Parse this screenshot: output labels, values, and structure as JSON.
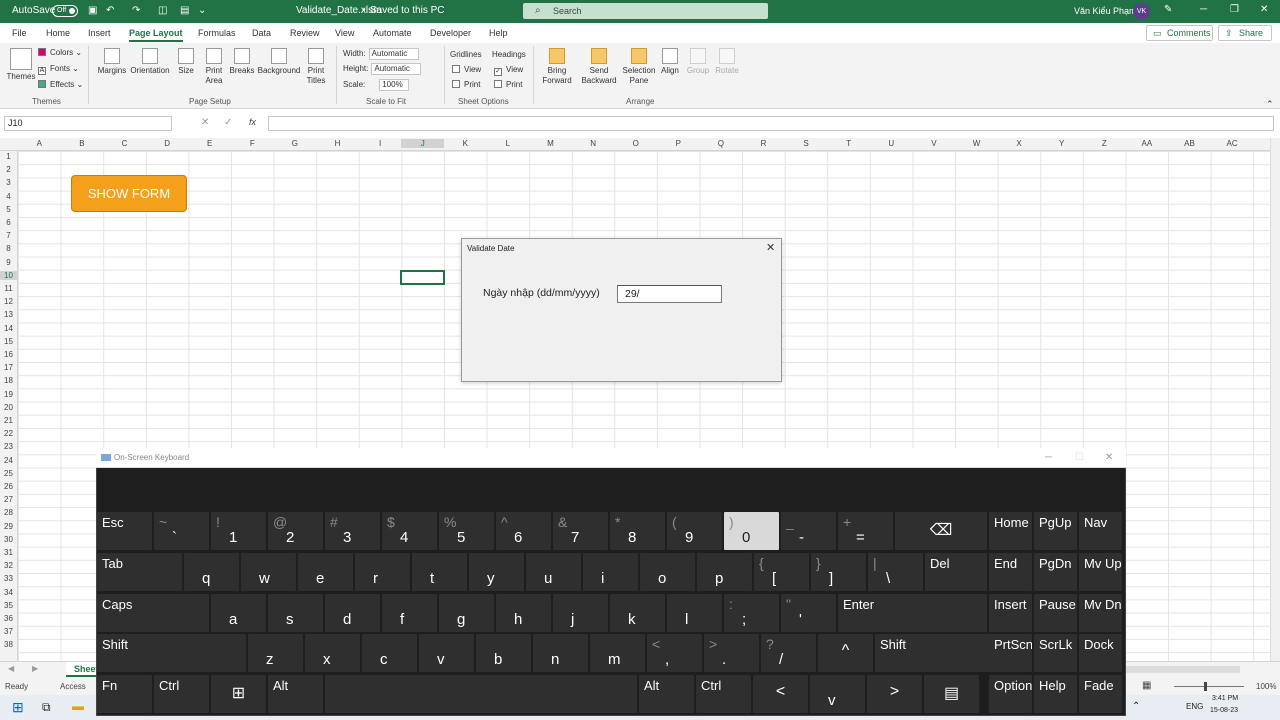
{
  "titlebar": {
    "autosave_label": "AutoSave",
    "autosave_state": "Off",
    "file_name": "Validate_Date.xlsm",
    "save_status": "Saved to this PC",
    "search_placeholder": "Search",
    "user_name": "Văn Kiểu Phạm",
    "user_initials": "VK"
  },
  "menu": [
    "File",
    "Home",
    "Insert",
    "Page Layout",
    "Formulas",
    "Data",
    "Review",
    "View",
    "Automate",
    "Developer",
    "Help"
  ],
  "menu_active": "Page Layout",
  "top_buttons": {
    "comments": "Comments",
    "share": "Share"
  },
  "ribbon": {
    "themes": {
      "themes": "Themes",
      "colors": "Colors",
      "fonts": "Fonts",
      "effects": "Effects",
      "group": "Themes"
    },
    "page_setup": {
      "margins": "Margins",
      "orientation": "Orientation",
      "size": "Size",
      "print_area": "Print Area",
      "breaks": "Breaks",
      "background": "Background",
      "print_titles": "Print Titles",
      "group": "Page Setup"
    },
    "scale": {
      "width_label": "Width:",
      "width_value": "Automatic",
      "height_label": "Height:",
      "height_value": "Automatic",
      "scale_label": "Scale:",
      "scale_value": "100%",
      "group": "Scale to Fit"
    },
    "sheet_options": {
      "gridlines": "Gridlines",
      "headings": "Headings",
      "view": "View",
      "print": "Print",
      "group": "Sheet Options"
    },
    "arrange": {
      "bring_forward": "Bring Forward",
      "send_backward": "Send Backward",
      "selection_pane": "Selection Pane",
      "align": "Align",
      "group_btn": "Group",
      "rotate": "Rotate",
      "group": "Arrange"
    }
  },
  "formula_bar": {
    "name_box": "J10",
    "fx": "fx"
  },
  "columns": [
    "A",
    "B",
    "C",
    "D",
    "E",
    "F",
    "G",
    "H",
    "I",
    "J",
    "K",
    "L",
    "M",
    "N",
    "O",
    "P",
    "Q",
    "R",
    "S",
    "T",
    "U",
    "V",
    "W",
    "X",
    "Y",
    "Z",
    "AA",
    "AB",
    "AC"
  ],
  "rows": [
    "1",
    "2",
    "3",
    "4",
    "5",
    "6",
    "7",
    "8",
    "9",
    "10",
    "11",
    "12",
    "13",
    "14",
    "15",
    "16",
    "17",
    "18",
    "19",
    "20",
    "21",
    "22",
    "23",
    "24",
    "25",
    "26",
    "27",
    "28",
    "29",
    "30",
    "31",
    "32",
    "33",
    "34",
    "35",
    "36",
    "37",
    "38"
  ],
  "selected_cell": "J10",
  "show_form_button": "SHOW FORM",
  "dialog": {
    "title": "Validate Date",
    "label": "Ngày nhập (dd/mm/yyyy)",
    "input_value": "29/"
  },
  "sheet_tab": "Sheet",
  "status": {
    "ready": "Ready",
    "accessibility": "Access",
    "zoom": "100%",
    "time": "3:41 PM",
    "date": "15-08-23",
    "language": "ENG"
  },
  "osk": {
    "title": "On-Screen Keyboard",
    "rows": [
      [
        {
          "label": "Esc"
        },
        {
          "up": "~",
          "dn": "`"
        },
        {
          "up": "!",
          "dn": "1"
        },
        {
          "up": "@",
          "dn": "2"
        },
        {
          "up": "#",
          "dn": "3"
        },
        {
          "up": "$",
          "dn": "4"
        },
        {
          "up": "%",
          "dn": "5"
        },
        {
          "up": "^",
          "dn": "6"
        },
        {
          "up": "&",
          "dn": "7"
        },
        {
          "up": "*",
          "dn": "8"
        },
        {
          "up": "(",
          "dn": "9"
        },
        {
          "up": ")",
          "dn": "0"
        },
        {
          "up": "_",
          "dn": "-"
        },
        {
          "up": "+",
          "dn": "="
        },
        {
          "label": "⌫"
        }
      ],
      [
        {
          "label": "Tab"
        },
        {
          "label": "q"
        },
        {
          "label": "w"
        },
        {
          "label": "e"
        },
        {
          "label": "r"
        },
        {
          "label": "t"
        },
        {
          "label": "y"
        },
        {
          "label": "u"
        },
        {
          "label": "i"
        },
        {
          "label": "o"
        },
        {
          "label": "p"
        },
        {
          "up": "{",
          "dn": "["
        },
        {
          "up": "}",
          "dn": "]"
        },
        {
          "up": "|",
          "dn": "\\"
        },
        {
          "label": "Del"
        }
      ],
      [
        {
          "label": "Caps"
        },
        {
          "label": "a"
        },
        {
          "label": "s"
        },
        {
          "label": "d"
        },
        {
          "label": "f"
        },
        {
          "label": "g"
        },
        {
          "label": "h"
        },
        {
          "label": "j"
        },
        {
          "label": "k"
        },
        {
          "label": "l"
        },
        {
          "up": ":",
          "dn": ";"
        },
        {
          "up": "\"",
          "dn": "'"
        },
        {
          "label": "Enter"
        }
      ],
      [
        {
          "label": "Shift"
        },
        {
          "label": "z"
        },
        {
          "label": "x"
        },
        {
          "label": "c"
        },
        {
          "label": "v"
        },
        {
          "label": "b"
        },
        {
          "label": "n"
        },
        {
          "label": "m"
        },
        {
          "up": "<",
          "dn": ","
        },
        {
          "up": ">",
          "dn": "."
        },
        {
          "up": "?",
          "dn": "/"
        },
        {
          "label": "^"
        },
        {
          "label": "Shift"
        }
      ],
      [
        {
          "label": "Fn"
        },
        {
          "label": "Ctrl"
        },
        {
          "label": "⊞"
        },
        {
          "label": "Alt"
        },
        {
          "label": ""
        },
        {
          "label": "Alt"
        },
        {
          "label": "Ctrl"
        },
        {
          "label": "<"
        },
        {
          "label": "v"
        },
        {
          "label": ">"
        },
        {
          "label": "▤"
        }
      ]
    ],
    "nav": [
      [
        "Home",
        "PgUp",
        "Nav"
      ],
      [
        "End",
        "PgDn",
        "Mv Up"
      ],
      [
        "Insert",
        "Pause",
        "Mv Dn"
      ],
      [
        "PrtScn",
        "ScrLk",
        "Dock"
      ],
      [
        "Options",
        "Help",
        "Fade"
      ]
    ],
    "pressed_key": "0"
  }
}
